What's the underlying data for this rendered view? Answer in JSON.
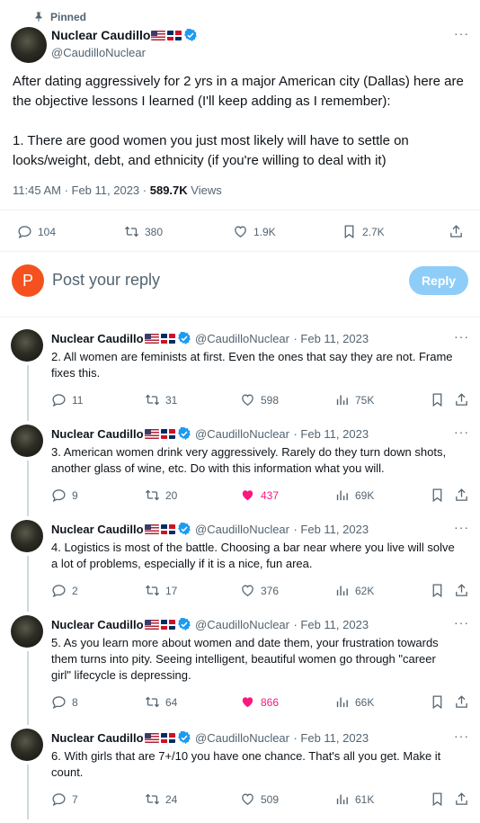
{
  "main_tweet": {
    "pinned_label": "Pinned",
    "author_name": "Nuclear Caudillo",
    "author_handle": "@CaudilloNuclear",
    "text_line1": "After dating aggressively for 2 yrs in a major American city (Dallas) here are",
    "text_line2": "the objective lessons I learned (I'll keep adding as I remember):",
    "text_line3": "1. There are good women you just most likely will have to settle on",
    "text_line4": "looks/weight, debt, and ethnicity (if you're willing to deal with it)",
    "timestamp": "11:45 AM · Feb 11, 2023 ·",
    "views_count": "589.7K",
    "views_label": "Views",
    "replies": "104",
    "retweets": "380",
    "likes": "1.9K",
    "bookmarks": "2.7K"
  },
  "composer": {
    "avatar_letter": "P",
    "avatar_color": "#f4511e",
    "placeholder": "Post your reply",
    "reply_button": "Reply"
  },
  "replies": [
    {
      "name": "Nuclear Caudillo",
      "handle": "@CaudilloNuclear",
      "date": "· Feb 11, 2023",
      "lines": [
        "2. All women are feminists at first. Even the ones that say they are not. Frame",
        "fixes this."
      ],
      "replies": "11",
      "retweets": "31",
      "likes": "598",
      "liked": false,
      "views": "75K"
    },
    {
      "name": "Nuclear Caudillo",
      "handle": "@CaudilloNuclear",
      "date": "· Feb 11, 2023",
      "lines": [
        "3. American women drink very aggressively. Rarely do they turn down shots,",
        "another glass of wine, etc. Do with this information what you will."
      ],
      "replies": "9",
      "retweets": "20",
      "likes": "437",
      "liked": true,
      "views": "69K"
    },
    {
      "name": "Nuclear Caudillo",
      "handle": "@CaudilloNuclear",
      "date": "· Feb 11, 2023",
      "lines": [
        "4. Logistics is most of the battle. Choosing a bar near where you live will solve",
        "a lot of problems, especially if it is a nice, fun area."
      ],
      "replies": "2",
      "retweets": "17",
      "likes": "376",
      "liked": false,
      "views": "62K"
    },
    {
      "name": "Nuclear Caudillo",
      "handle": "@CaudilloNuclear",
      "date": "· Feb 11, 2023",
      "lines": [
        "5. As you learn more about women and date them, your frustration towards",
        "them turns into pity. Seeing intelligent, beautiful women go through \"career",
        "girl\" lifecycle is depressing."
      ],
      "replies": "8",
      "retweets": "64",
      "likes": "866",
      "liked": true,
      "views": "66K"
    },
    {
      "name": "Nuclear Caudillo",
      "handle": "@CaudilloNuclear",
      "date": "· Feb 11, 2023",
      "lines": [
        "6. With girls that are 7+/10 you have one chance. That's all you get. Make it",
        "count."
      ],
      "replies": "7",
      "retweets": "24",
      "likes": "509",
      "liked": false,
      "views": "61K"
    }
  ],
  "colors": {
    "accent": "#1d9bf0",
    "liked": "#f91880",
    "reply_button_bg": "#8ecdf8",
    "muted": "#536471"
  },
  "icons": [
    "pin-icon",
    "verified-icon",
    "more-icon",
    "reply-icon",
    "retweet-icon",
    "like-icon",
    "bookmark-icon",
    "share-icon",
    "views-icon"
  ]
}
